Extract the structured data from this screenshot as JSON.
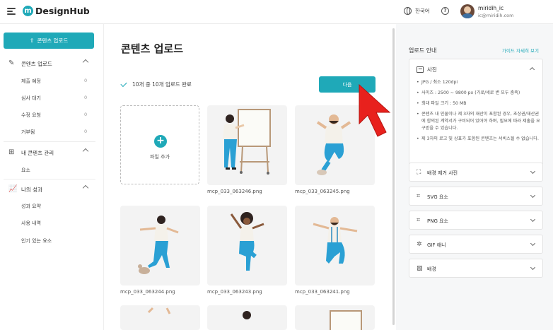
{
  "header": {
    "logo_mark": "m",
    "logo_text": "DesignHub",
    "language": "한국어",
    "help": "?",
    "user_name": "miridih_ic",
    "user_email": "ic@miridih.com"
  },
  "sidebar": {
    "upload_button": "콘텐츠 업로드",
    "groups": [
      {
        "label": "콘텐츠 업로드",
        "icon": "pencil-icon",
        "items": [
          {
            "label": "제출 예정",
            "count": "0"
          },
          {
            "label": "심사 대기",
            "count": "0"
          },
          {
            "label": "수정 요청",
            "count": "0"
          },
          {
            "label": "거부됨",
            "count": "0"
          }
        ]
      },
      {
        "label": "내 콘텐츠 관리",
        "icon": "grid-icon",
        "items": [
          {
            "label": "요소"
          }
        ]
      },
      {
        "label": "나의 성과",
        "icon": "chart-icon",
        "items": [
          {
            "label": "성과 요약"
          },
          {
            "label": "사용 내역"
          },
          {
            "label": "인기 있는 요소"
          }
        ]
      }
    ]
  },
  "main": {
    "title": "콘텐츠 업로드",
    "status": "10개 중 10개 업로드 완료",
    "next_button": "다음",
    "add_file": "파일 추가",
    "files": [
      {
        "name": "mcp_033_063246.png"
      },
      {
        "name": "mcp_033_063245.png"
      },
      {
        "name": "mcp_033_063244.png"
      },
      {
        "name": "mcp_033_063243.png"
      },
      {
        "name": "mcp_033_063241.png"
      }
    ]
  },
  "guide": {
    "title": "업로드 안내",
    "link": "가이드 자세히 보기",
    "photo": {
      "label": "사진",
      "bullets": [
        "JPG / 최소 120dpi",
        "사이즈 : 2500 ~ 9800 px (가로/세로 변 모두 충족)",
        "최대 파일 크기 : 50 MB",
        "콘텐츠 내 인물이나 제 3자의 재산이 포함된 경우, 초상권/재산권에 합의된 계약서가 구비되어 있어야 하며, 필요에 따라 제출을 요구받을 수 있습니다.",
        "제 3자의 로고 및 상표가 포함된 콘텐츠는 서비스될 수 없습니다."
      ]
    },
    "sections": [
      {
        "label": "배경 제거 사진",
        "icon": "cutout-icon"
      },
      {
        "label": "SVG 요소",
        "icon": "vector-icon"
      },
      {
        "label": "PNG 요소",
        "icon": "vector-icon"
      },
      {
        "label": "GIF 애니",
        "icon": "gif-icon"
      },
      {
        "label": "배경",
        "icon": "pattern-icon"
      }
    ]
  },
  "colors": {
    "accent": "#1fa9b8",
    "arrow": "#e8211d"
  }
}
